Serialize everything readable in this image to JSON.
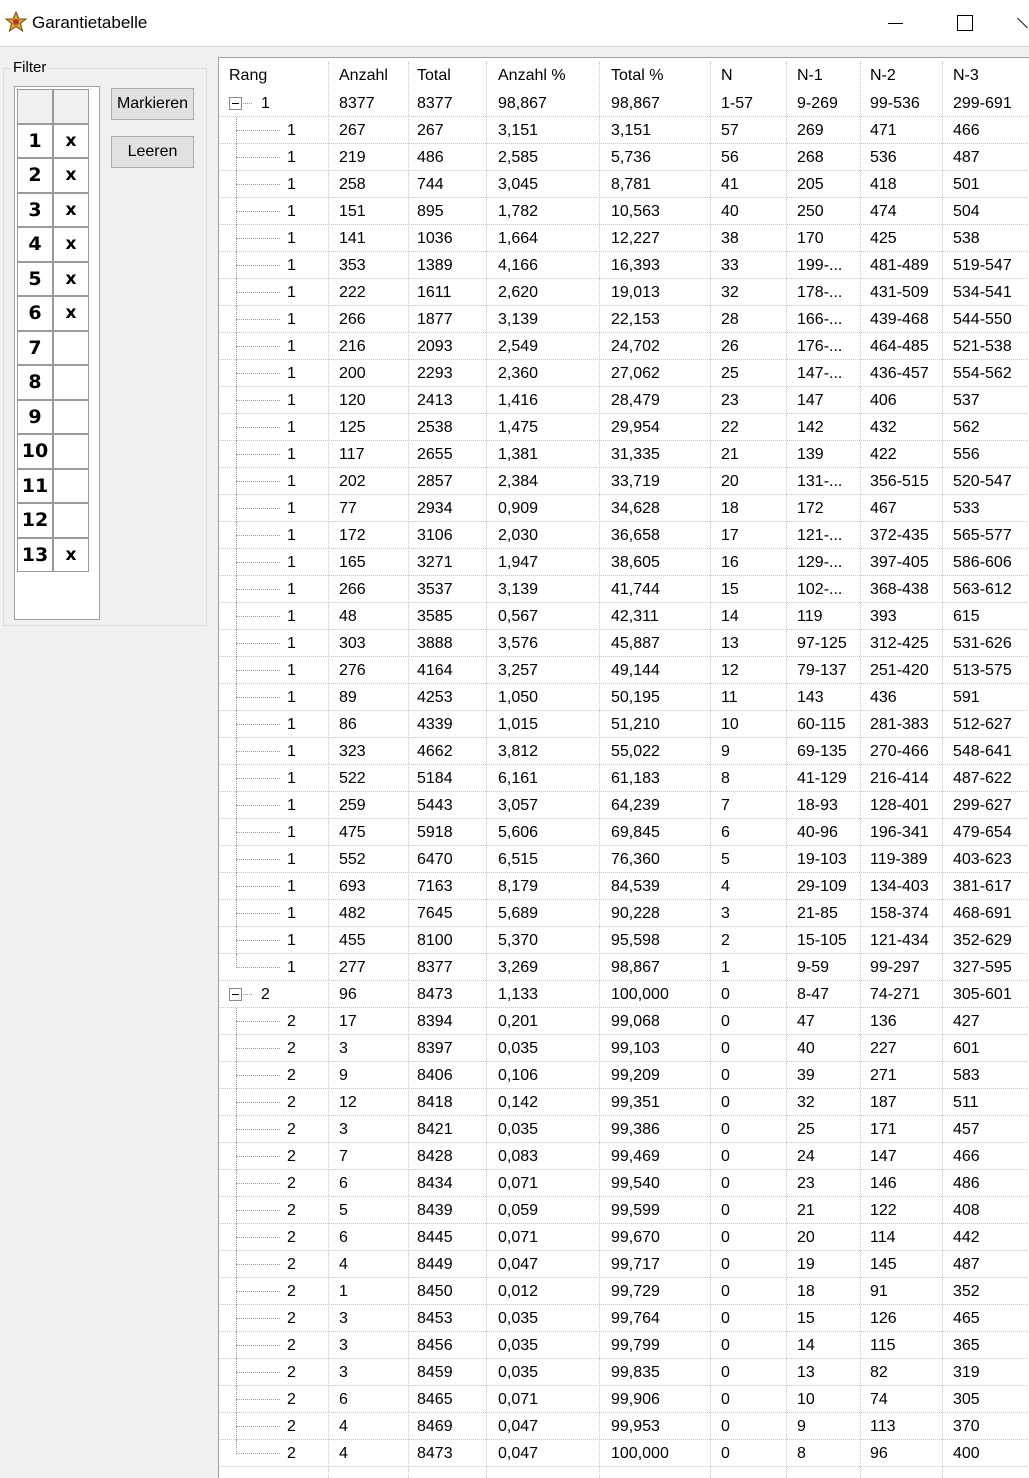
{
  "window": {
    "title": "Garantietabelle"
  },
  "filter": {
    "legend": "Filter",
    "rows": [
      {
        "num": "1",
        "mark": "x"
      },
      {
        "num": "2",
        "mark": "x"
      },
      {
        "num": "3",
        "mark": "x"
      },
      {
        "num": "4",
        "mark": "x"
      },
      {
        "num": "5",
        "mark": "x"
      },
      {
        "num": "6",
        "mark": "x"
      },
      {
        "num": "7",
        "mark": ""
      },
      {
        "num": "8",
        "mark": ""
      },
      {
        "num": "9",
        "mark": ""
      },
      {
        "num": "10",
        "mark": ""
      },
      {
        "num": "11",
        "mark": ""
      },
      {
        "num": "12",
        "mark": ""
      },
      {
        "num": "13",
        "mark": "x"
      }
    ],
    "mark_button": "Markieren",
    "clear_button": "Leeren"
  },
  "table": {
    "columns": [
      "Rang",
      "Anzahl",
      "Total",
      "Anzahl %",
      "Total %",
      "N",
      "N-1",
      "N-2",
      "N-3"
    ],
    "rows": [
      {
        "level": 0,
        "cells": [
          "1",
          "8377",
          "8377",
          "98,867",
          "98,867",
          "1-57",
          "9-269",
          "99-536",
          "299-691"
        ]
      },
      {
        "level": 1,
        "cells": [
          "1",
          "267",
          "267",
          "3,151",
          "3,151",
          "57",
          "269",
          "471",
          "466"
        ]
      },
      {
        "level": 1,
        "cells": [
          "1",
          "219",
          "486",
          "2,585",
          "5,736",
          "56",
          "268",
          "536",
          "487"
        ]
      },
      {
        "level": 1,
        "cells": [
          "1",
          "258",
          "744",
          "3,045",
          "8,781",
          "41",
          "205",
          "418",
          "501"
        ]
      },
      {
        "level": 1,
        "cells": [
          "1",
          "151",
          "895",
          "1,782",
          "10,563",
          "40",
          "250",
          "474",
          "504"
        ]
      },
      {
        "level": 1,
        "cells": [
          "1",
          "141",
          "1036",
          "1,664",
          "12,227",
          "38",
          "170",
          "425",
          "538"
        ]
      },
      {
        "level": 1,
        "cells": [
          "1",
          "353",
          "1389",
          "4,166",
          "16,393",
          "33",
          "199-...",
          "481-489",
          "519-547"
        ]
      },
      {
        "level": 1,
        "cells": [
          "1",
          "222",
          "1611",
          "2,620",
          "19,013",
          "32",
          "178-...",
          "431-509",
          "534-541"
        ]
      },
      {
        "level": 1,
        "cells": [
          "1",
          "266",
          "1877",
          "3,139",
          "22,153",
          "28",
          "166-...",
          "439-468",
          "544-550"
        ]
      },
      {
        "level": 1,
        "cells": [
          "1",
          "216",
          "2093",
          "2,549",
          "24,702",
          "26",
          "176-...",
          "464-485",
          "521-538"
        ]
      },
      {
        "level": 1,
        "cells": [
          "1",
          "200",
          "2293",
          "2,360",
          "27,062",
          "25",
          "147-...",
          "436-457",
          "554-562"
        ]
      },
      {
        "level": 1,
        "cells": [
          "1",
          "120",
          "2413",
          "1,416",
          "28,479",
          "23",
          "147",
          "406",
          "537"
        ]
      },
      {
        "level": 1,
        "cells": [
          "1",
          "125",
          "2538",
          "1,475",
          "29,954",
          "22",
          "142",
          "432",
          "562"
        ]
      },
      {
        "level": 1,
        "cells": [
          "1",
          "117",
          "2655",
          "1,381",
          "31,335",
          "21",
          "139",
          "422",
          "556"
        ]
      },
      {
        "level": 1,
        "cells": [
          "1",
          "202",
          "2857",
          "2,384",
          "33,719",
          "20",
          "131-...",
          "356-515",
          "520-547"
        ]
      },
      {
        "level": 1,
        "cells": [
          "1",
          "77",
          "2934",
          "0,909",
          "34,628",
          "18",
          "172",
          "467",
          "533"
        ]
      },
      {
        "level": 1,
        "cells": [
          "1",
          "172",
          "3106",
          "2,030",
          "36,658",
          "17",
          "121-...",
          "372-435",
          "565-577"
        ]
      },
      {
        "level": 1,
        "cells": [
          "1",
          "165",
          "3271",
          "1,947",
          "38,605",
          "16",
          "129-...",
          "397-405",
          "586-606"
        ]
      },
      {
        "level": 1,
        "cells": [
          "1",
          "266",
          "3537",
          "3,139",
          "41,744",
          "15",
          "102-...",
          "368-438",
          "563-612"
        ]
      },
      {
        "level": 1,
        "cells": [
          "1",
          "48",
          "3585",
          "0,567",
          "42,311",
          "14",
          "119",
          "393",
          "615"
        ]
      },
      {
        "level": 1,
        "cells": [
          "1",
          "303",
          "3888",
          "3,576",
          "45,887",
          "13",
          "97-125",
          "312-425",
          "531-626"
        ]
      },
      {
        "level": 1,
        "cells": [
          "1",
          "276",
          "4164",
          "3,257",
          "49,144",
          "12",
          "79-137",
          "251-420",
          "513-575"
        ]
      },
      {
        "level": 1,
        "cells": [
          "1",
          "89",
          "4253",
          "1,050",
          "50,195",
          "11",
          "143",
          "436",
          "591"
        ]
      },
      {
        "level": 1,
        "cells": [
          "1",
          "86",
          "4339",
          "1,015",
          "51,210",
          "10",
          "60-115",
          "281-383",
          "512-627"
        ]
      },
      {
        "level": 1,
        "cells": [
          "1",
          "323",
          "4662",
          "3,812",
          "55,022",
          "9",
          "69-135",
          "270-466",
          "548-641"
        ]
      },
      {
        "level": 1,
        "cells": [
          "1",
          "522",
          "5184",
          "6,161",
          "61,183",
          "8",
          "41-129",
          "216-414",
          "487-622"
        ]
      },
      {
        "level": 1,
        "cells": [
          "1",
          "259",
          "5443",
          "3,057",
          "64,239",
          "7",
          "18-93",
          "128-401",
          "299-627"
        ]
      },
      {
        "level": 1,
        "cells": [
          "1",
          "475",
          "5918",
          "5,606",
          "69,845",
          "6",
          "40-96",
          "196-341",
          "479-654"
        ]
      },
      {
        "level": 1,
        "cells": [
          "1",
          "552",
          "6470",
          "6,515",
          "76,360",
          "5",
          "19-103",
          "119-389",
          "403-623"
        ]
      },
      {
        "level": 1,
        "cells": [
          "1",
          "693",
          "7163",
          "8,179",
          "84,539",
          "4",
          "29-109",
          "134-403",
          "381-617"
        ]
      },
      {
        "level": 1,
        "cells": [
          "1",
          "482",
          "7645",
          "5,689",
          "90,228",
          "3",
          "21-85",
          "158-374",
          "468-691"
        ]
      },
      {
        "level": 1,
        "cells": [
          "1",
          "455",
          "8100",
          "5,370",
          "95,598",
          "2",
          "15-105",
          "121-434",
          "352-629"
        ]
      },
      {
        "level": 1,
        "cells": [
          "1",
          "277",
          "8377",
          "3,269",
          "98,867",
          "1",
          "9-59",
          "99-297",
          "327-595"
        ]
      },
      {
        "level": 0,
        "cells": [
          "2",
          "96",
          "8473",
          "1,133",
          "100,000",
          "0",
          "8-47",
          "74-271",
          "305-601"
        ]
      },
      {
        "level": 1,
        "cells": [
          "2",
          "17",
          "8394",
          "0,201",
          "99,068",
          "0",
          "47",
          "136",
          "427"
        ]
      },
      {
        "level": 1,
        "cells": [
          "2",
          "3",
          "8397",
          "0,035",
          "99,103",
          "0",
          "40",
          "227",
          "601"
        ]
      },
      {
        "level": 1,
        "cells": [
          "2",
          "9",
          "8406",
          "0,106",
          "99,209",
          "0",
          "39",
          "271",
          "583"
        ]
      },
      {
        "level": 1,
        "cells": [
          "2",
          "12",
          "8418",
          "0,142",
          "99,351",
          "0",
          "32",
          "187",
          "511"
        ]
      },
      {
        "level": 1,
        "cells": [
          "2",
          "3",
          "8421",
          "0,035",
          "99,386",
          "0",
          "25",
          "171",
          "457"
        ]
      },
      {
        "level": 1,
        "cells": [
          "2",
          "7",
          "8428",
          "0,083",
          "99,469",
          "0",
          "24",
          "147",
          "466"
        ]
      },
      {
        "level": 1,
        "cells": [
          "2",
          "6",
          "8434",
          "0,071",
          "99,540",
          "0",
          "23",
          "146",
          "486"
        ]
      },
      {
        "level": 1,
        "cells": [
          "2",
          "5",
          "8439",
          "0,059",
          "99,599",
          "0",
          "21",
          "122",
          "408"
        ]
      },
      {
        "level": 1,
        "cells": [
          "2",
          "6",
          "8445",
          "0,071",
          "99,670",
          "0",
          "20",
          "114",
          "442"
        ]
      },
      {
        "level": 1,
        "cells": [
          "2",
          "4",
          "8449",
          "0,047",
          "99,717",
          "0",
          "19",
          "145",
          "487"
        ]
      },
      {
        "level": 1,
        "cells": [
          "2",
          "1",
          "8450",
          "0,012",
          "99,729",
          "0",
          "18",
          "91",
          "352"
        ]
      },
      {
        "level": 1,
        "cells": [
          "2",
          "3",
          "8453",
          "0,035",
          "99,764",
          "0",
          "15",
          "126",
          "465"
        ]
      },
      {
        "level": 1,
        "cells": [
          "2",
          "3",
          "8456",
          "0,035",
          "99,799",
          "0",
          "14",
          "115",
          "365"
        ]
      },
      {
        "level": 1,
        "cells": [
          "2",
          "3",
          "8459",
          "0,035",
          "99,835",
          "0",
          "13",
          "82",
          "319"
        ]
      },
      {
        "level": 1,
        "cells": [
          "2",
          "6",
          "8465",
          "0,071",
          "99,906",
          "0",
          "10",
          "74",
          "305"
        ]
      },
      {
        "level": 1,
        "cells": [
          "2",
          "4",
          "8469",
          "0,047",
          "99,953",
          "0",
          "9",
          "113",
          "370"
        ]
      },
      {
        "level": 1,
        "cells": [
          "2",
          "4",
          "8473",
          "0,047",
          "100,000",
          "0",
          "8",
          "96",
          "400"
        ]
      }
    ]
  }
}
